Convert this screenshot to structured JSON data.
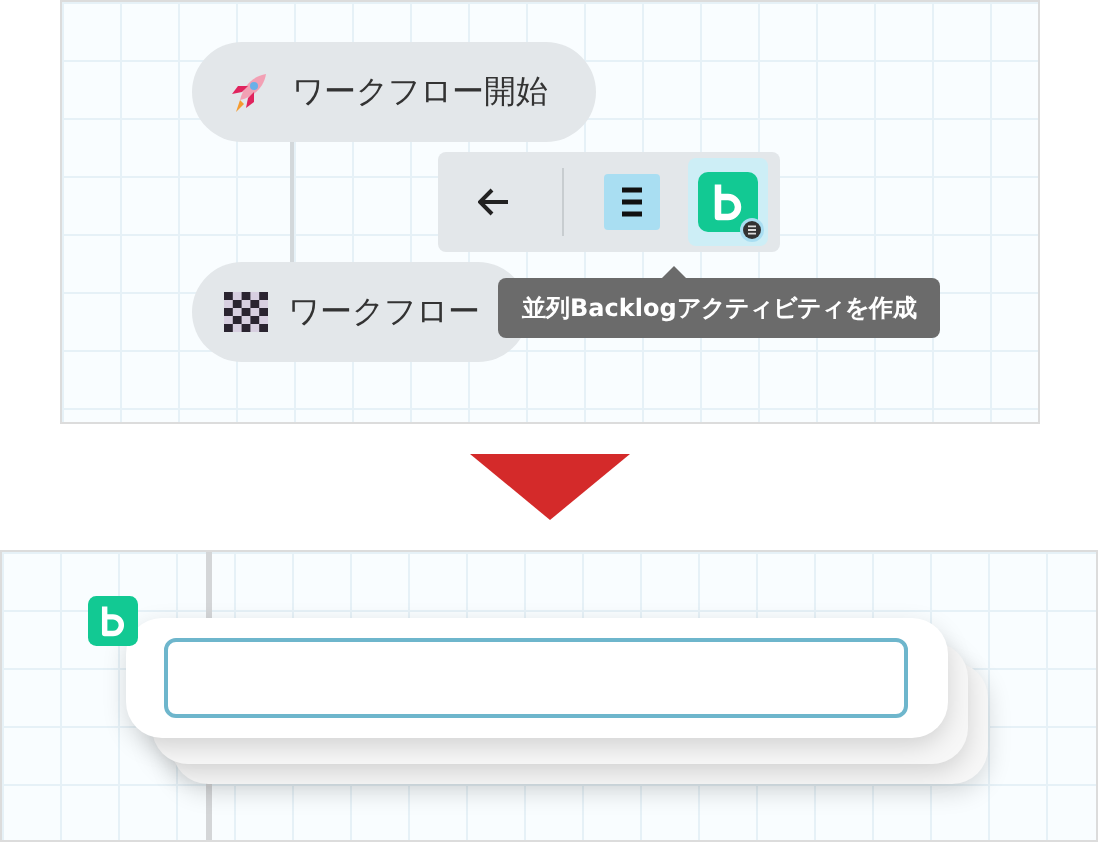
{
  "top_canvas": {
    "nodes": [
      {
        "kind": "start",
        "label": "ワークフロー開始"
      },
      {
        "kind": "end",
        "label": "ワークフロー"
      }
    ],
    "toolbar": [
      {
        "kind": "back",
        "selected": false
      },
      {
        "kind": "parallel",
        "selected": false
      },
      {
        "kind": "backlog",
        "selected": true
      }
    ],
    "tooltip": "並列Backlogアクティビティを作成"
  },
  "bottom_canvas": {
    "icon": {
      "kind": "backlog"
    },
    "card_stack": [
      {
        "kind": "shadow"
      },
      {
        "kind": "shadow"
      },
      {
        "kind": "editor"
      }
    ]
  }
}
